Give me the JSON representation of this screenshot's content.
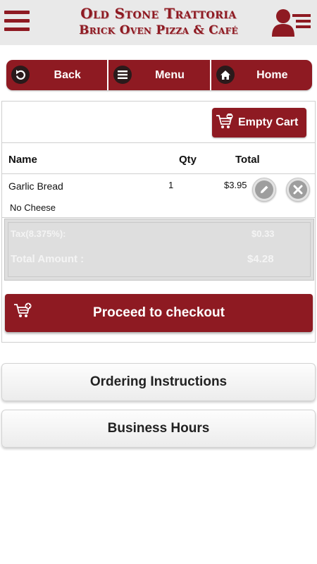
{
  "header": {
    "brand_line1": "Old Stone Trattoria",
    "brand_line2": "Brick Oven Pizza & Café",
    "menu_icon": "hamburger-icon",
    "account_icon": "user-list-icon"
  },
  "nav": {
    "back_label": "Back",
    "menu_label": "Menu",
    "home_label": "Home"
  },
  "cart": {
    "empty_cart_label": "Empty Cart",
    "columns": {
      "name": "Name",
      "qty": "Qty",
      "total": "Total"
    },
    "items": [
      {
        "name": "Garlic Bread",
        "qty": "1",
        "total": "$3.95",
        "note": "No Cheese"
      }
    ],
    "tax_label": "Tax(8.375%):",
    "tax_value": "$0.33",
    "total_label": "Total Amount :",
    "total_value": "$4.28",
    "checkout_label": "Proceed to checkout"
  },
  "sections": {
    "ordering_instructions": "Ordering Instructions",
    "business_hours": "Business Hours"
  },
  "colors": {
    "brand": "#8e1a22",
    "header_bg": "#e9e9e9",
    "summary_bg": "#dedede"
  }
}
